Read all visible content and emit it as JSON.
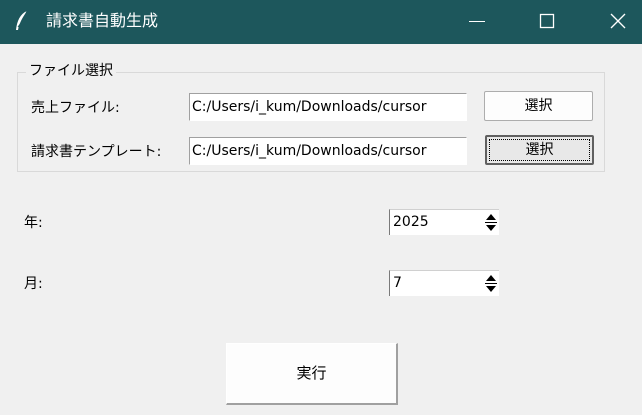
{
  "window": {
    "title": "請求書自動生成",
    "title_icon": "feather-icon",
    "titlebar_color": "#1d575c"
  },
  "file_group": {
    "legend": "ファイル選択",
    "sales_file": {
      "label": "売上ファイル:",
      "value": "C:/Users/i_kum/Downloads/cursor",
      "button_label": "選択"
    },
    "template_file": {
      "label": "請求書テンプレート:",
      "value": "C:/Users/i_kum/Downloads/cursor",
      "button_label": "選択"
    }
  },
  "year": {
    "label": "年:",
    "value": "2025"
  },
  "month": {
    "label": "月:",
    "value": "7"
  },
  "run_button": {
    "label": "実行"
  }
}
